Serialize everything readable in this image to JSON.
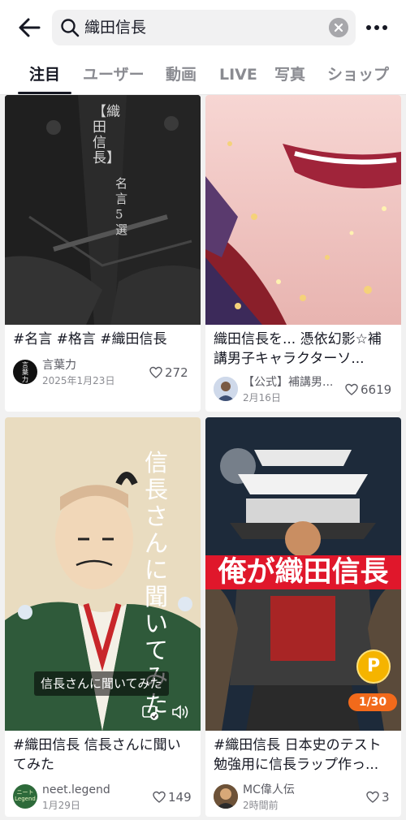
{
  "header": {
    "search_query": "織田信長"
  },
  "tabs": [
    {
      "label": "注目"
    },
    {
      "label": "ユーザー"
    },
    {
      "label": "動画"
    },
    {
      "label": "LIVE"
    },
    {
      "label": "写真"
    },
    {
      "label": "ショップ"
    }
  ],
  "cards": [
    {
      "overlay_title": "【織田信長】",
      "overlay_sub": "名言5選",
      "title": "#名言 #格言 #織田信長",
      "author": "言葉力",
      "avatar_text": "言葉力",
      "date": "2025年1月23日",
      "likes": "272"
    },
    {
      "title": "織田信長を... 憑依幻影☆補講男子キャラクターソ...",
      "author": "【公式】補講男...",
      "date": "2月16日",
      "likes": "6619"
    },
    {
      "overlay_vertical": "信長さんに聞いてみた",
      "caption": "信長さんに聞いてみた",
      "title": "#織田信長 信長さんに聞いてみた",
      "author": "neet.legend",
      "avatar_text": "ニート Legend",
      "date": "1月29日",
      "likes": "149"
    },
    {
      "overlay_banner": "俺が織田信長",
      "page_badge": "1/30",
      "coin_label": "P",
      "title": "#織田信長 日本史のテスト勉強用に信長ラップ作っ...",
      "author": "MC偉人伝",
      "date": "2時間前",
      "likes": "3"
    }
  ],
  "colors": {
    "accent_red": "#e0172b",
    "coin_yellow": "#f5b400",
    "badge_orange": "#f26a1b"
  }
}
